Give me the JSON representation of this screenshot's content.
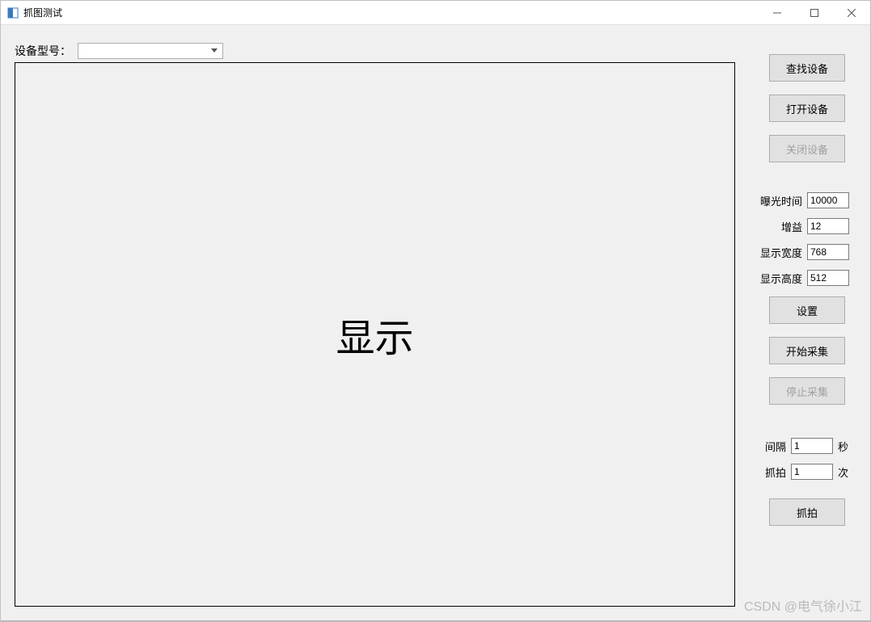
{
  "window": {
    "title": "抓图测试"
  },
  "top": {
    "device_label": "设备型号：",
    "device_selected": ""
  },
  "display": {
    "placeholder": "显示"
  },
  "buttons": {
    "find_device": "查找设备",
    "open_device": "打开设备",
    "close_device": "关闭设备",
    "set": "设置",
    "start_acq": "开始采集",
    "stop_acq": "停止采集",
    "snap": "抓拍"
  },
  "params": {
    "exposure": {
      "label": "曝光时间",
      "value": "10000"
    },
    "gain": {
      "label": "增益",
      "value": "12"
    },
    "disp_width": {
      "label": "显示宽度",
      "value": "768"
    },
    "disp_height": {
      "label": "显示高度",
      "value": "512"
    }
  },
  "snap": {
    "interval": {
      "label": "间隔",
      "value": "1",
      "unit": "秒"
    },
    "count": {
      "label": "抓拍",
      "value": "1",
      "unit": "次"
    }
  },
  "watermark": "CSDN @电气徐小江"
}
